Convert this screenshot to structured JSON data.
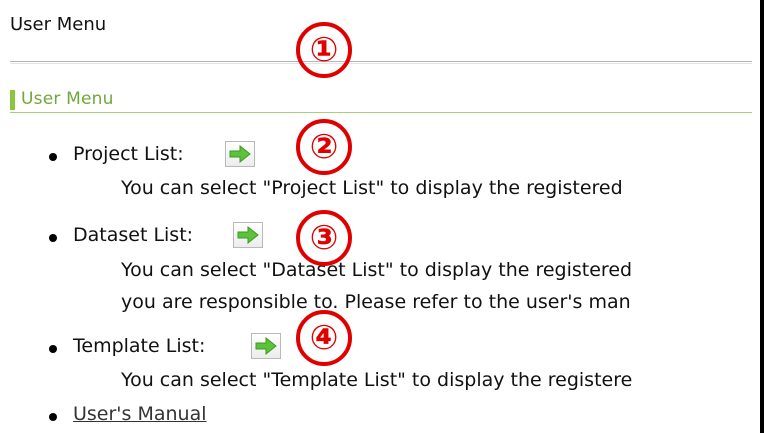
{
  "page": {
    "title": "User Menu"
  },
  "section": {
    "heading": "User Menu"
  },
  "menu_items": [
    {
      "label": "Project List:",
      "icon": "green-arrow-right-icon",
      "description_lines": [
        "You can select \"Project List\" to display the registered"
      ]
    },
    {
      "label": "Dataset List:",
      "icon": "green-arrow-right-icon",
      "description_lines": [
        "You can select \"Dataset List\" to display the registered",
        "you are responsible to. Please refer to the user's man"
      ]
    },
    {
      "label": "Template List:",
      "icon": "green-arrow-right-icon",
      "description_lines": [
        "You can select \"Template List\" to display the registere"
      ]
    }
  ],
  "manual_link": {
    "label": "User's Manual"
  },
  "annotations": [
    "①",
    "②",
    "③",
    "④"
  ],
  "colors": {
    "annotation": "#e00000",
    "section_accent": "#8cc63f",
    "section_text": "#6fa83a",
    "arrow_green": "#5cc23a"
  }
}
